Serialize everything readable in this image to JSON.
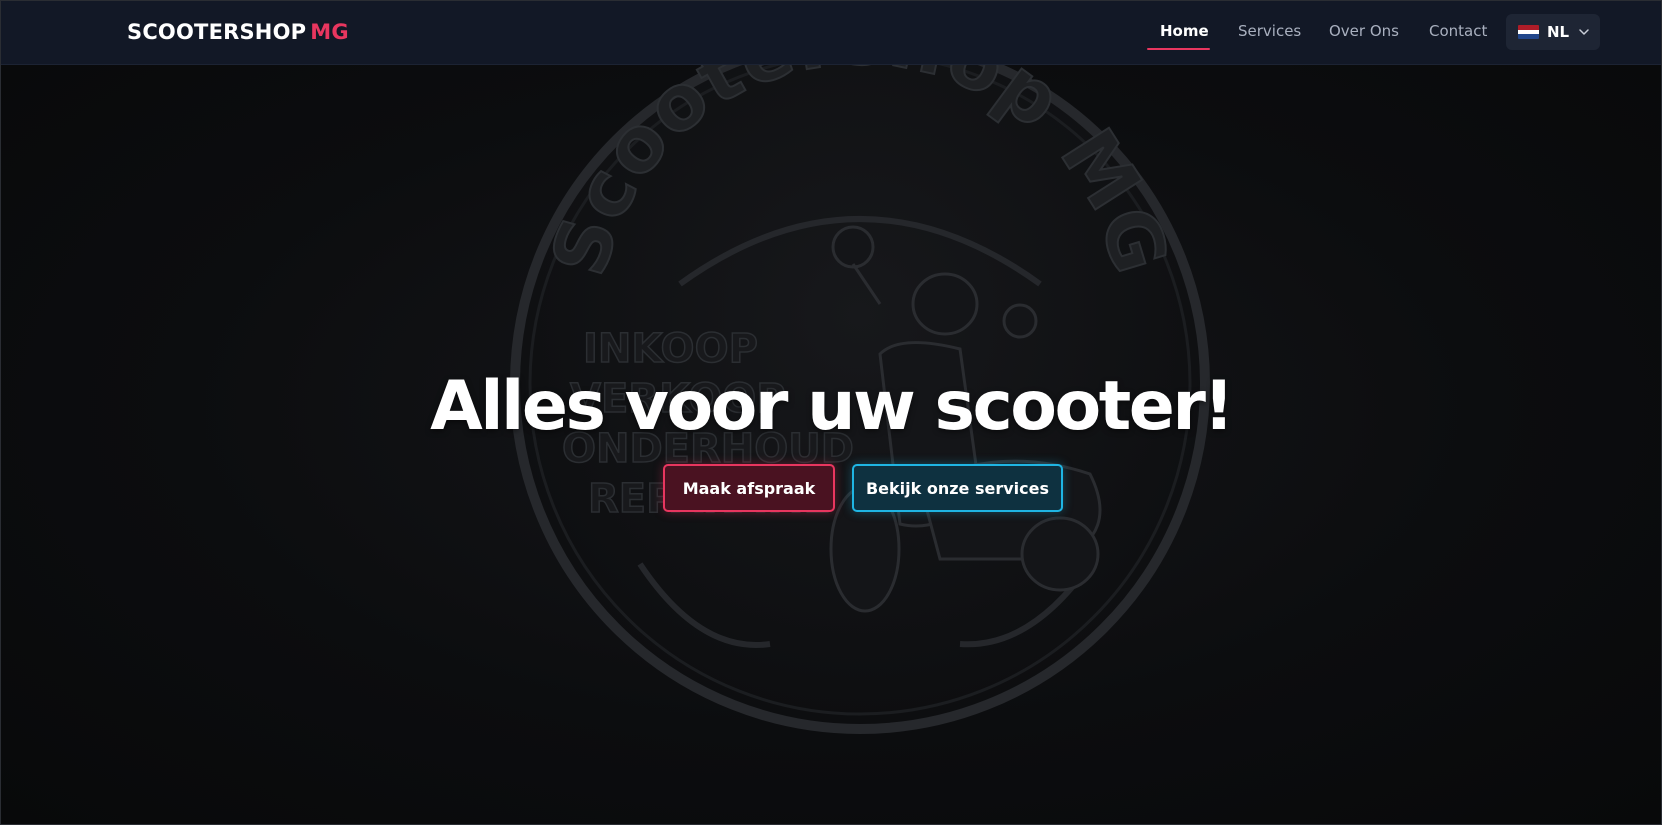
{
  "navbar": {
    "brand": "SCOOTERSHOP",
    "brand_accent": "MG",
    "links": [
      {
        "label": "Home",
        "active": true
      },
      {
        "label": "Services",
        "active": false
      },
      {
        "label": "Over Ons",
        "active": false
      },
      {
        "label": "Contact",
        "active": false
      }
    ],
    "language": {
      "code": "NL",
      "flag_icon": "netherlands-flag-icon"
    }
  },
  "hero": {
    "title": "Alles voor uw scooter!",
    "background_emblem": {
      "arc_text": "Scootershop MG",
      "lines": [
        "INKOOP",
        "VERKOOP",
        "ONDERHOUD",
        "REPARATIE"
      ]
    },
    "buttons": {
      "primary": "Maak afspraak",
      "secondary": "Bekijk onze services"
    }
  },
  "colors": {
    "accent": "#e8365f",
    "secondary_accent": "#1fb5e3",
    "navbar_bg": "#121826",
    "hero_bg": "#0a0b0d"
  }
}
